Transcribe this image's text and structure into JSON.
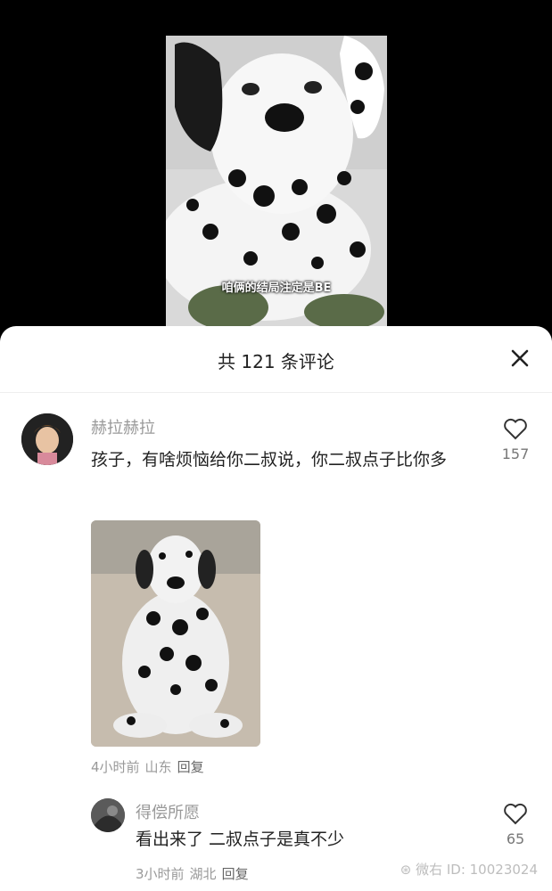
{
  "video": {
    "caption": "咱俩的结局注定是BE"
  },
  "sheet": {
    "title": "共 121 条评论"
  },
  "comments": [
    {
      "username": "赫拉赫拉",
      "text": "孩子，有啥烦恼给你二叔说，你二叔点子比你多",
      "time": "4小时前",
      "location": "山东",
      "reply": "回复",
      "likes": "157"
    },
    {
      "username": "得偿所愿",
      "text": "看出来了 二叔点子是真不少",
      "time": "3小时前",
      "location": "湖北",
      "reply": "回复",
      "likes": "65"
    }
  ],
  "watermark": "微右 ID: 10023024",
  "icons": [
    "close-icon",
    "heart-icon",
    "weibo-icon"
  ]
}
